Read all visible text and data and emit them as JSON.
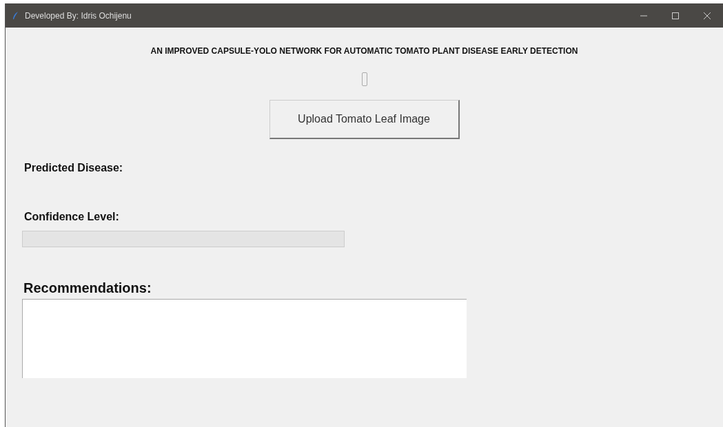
{
  "window": {
    "title": "Developed By: Idris Ochijenu"
  },
  "heading": "AN IMPROVED CAPSULE-YOLO NETWORK FOR AUTOMATIC TOMATO PLANT DISEASE EARLY DETECTION",
  "upload_button": "Upload Tomato Leaf Image",
  "predicted_label": "Predicted Disease:",
  "confidence": {
    "label": "Confidence Level:",
    "level": 0
  },
  "recommendations": {
    "label": "Recommendations:"
  }
}
